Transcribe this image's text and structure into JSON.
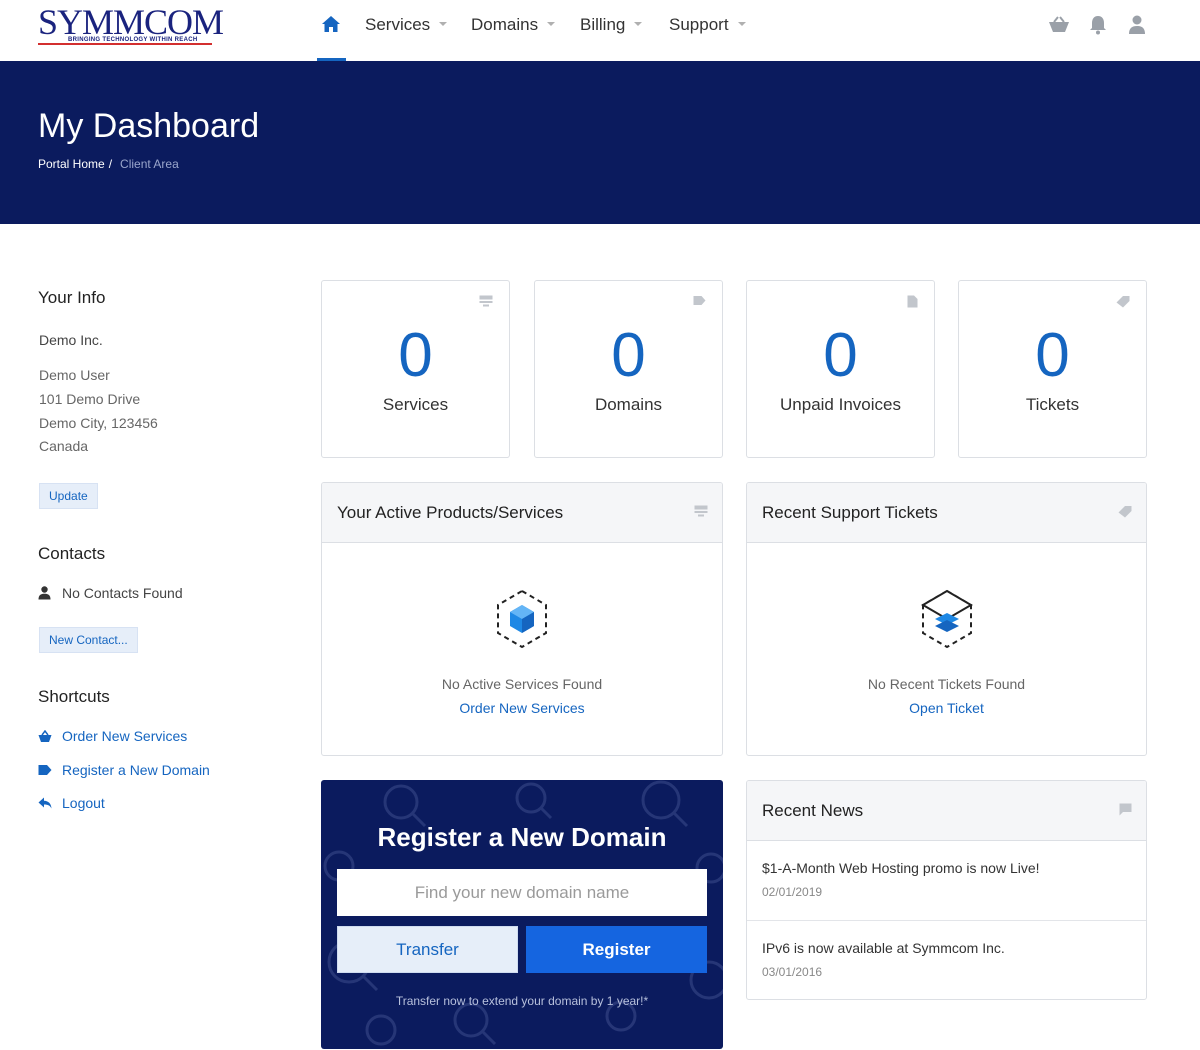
{
  "brand": {
    "name": "SYMMCOM",
    "tagline": "BRINGING TECHNOLOGY WITHIN REACH",
    "colors": {
      "primary": "#1565c0",
      "hero": "#0b1b5e",
      "logo_red": "#d32f2f"
    }
  },
  "nav": {
    "home_icon": "home-icon",
    "items": [
      {
        "label": "Services"
      },
      {
        "label": "Domains"
      },
      {
        "label": "Billing"
      },
      {
        "label": "Support"
      }
    ],
    "right_icons": [
      "cart-icon",
      "bell-icon",
      "user-icon"
    ]
  },
  "hero": {
    "title": "My Dashboard",
    "breadcrumb": {
      "home": "Portal Home",
      "separator": "/",
      "current": "Client Area"
    }
  },
  "sidebar": {
    "your_info": {
      "heading": "Your Info",
      "company": "Demo Inc.",
      "address": [
        "Demo User",
        "101 Demo Drive",
        "Demo City, 123456",
        "Canada"
      ],
      "update_button": "Update"
    },
    "contacts": {
      "heading": "Contacts",
      "empty": "No Contacts Found",
      "new_button": "New Contact..."
    },
    "shortcuts": {
      "heading": "Shortcuts",
      "items": [
        {
          "label": "Order New Services",
          "icon": "basket-icon"
        },
        {
          "label": "Register a New Domain",
          "icon": "tag-icon"
        },
        {
          "label": "Logout",
          "icon": "reply-icon"
        }
      ]
    }
  },
  "stats": [
    {
      "value": "0",
      "label": "Services",
      "icon": "server-icon"
    },
    {
      "value": "0",
      "label": "Domains",
      "icon": "tag-icon"
    },
    {
      "value": "0",
      "label": "Unpaid Invoices",
      "icon": "file-icon"
    },
    {
      "value": "0",
      "label": "Tickets",
      "icon": "ticket-icon"
    }
  ],
  "products_panel": {
    "title": "Your Active Products/Services",
    "empty_message": "No Active Services Found",
    "link": "Order New Services"
  },
  "tickets_panel": {
    "title": "Recent Support Tickets",
    "empty_message": "No Recent Tickets Found",
    "link": "Open Ticket"
  },
  "domain_register": {
    "title": "Register a New Domain",
    "placeholder": "Find your new domain name",
    "transfer_label": "Transfer",
    "register_label": "Register",
    "note": "Transfer now to extend your domain by 1 year!*"
  },
  "news": {
    "title": "Recent News",
    "items": [
      {
        "title": "$1-A-Month Web Hosting promo is now Live!",
        "date": "02/01/2019"
      },
      {
        "title": "IPv6 is now available at Symmcom Inc.",
        "date": "03/01/2016"
      }
    ]
  }
}
